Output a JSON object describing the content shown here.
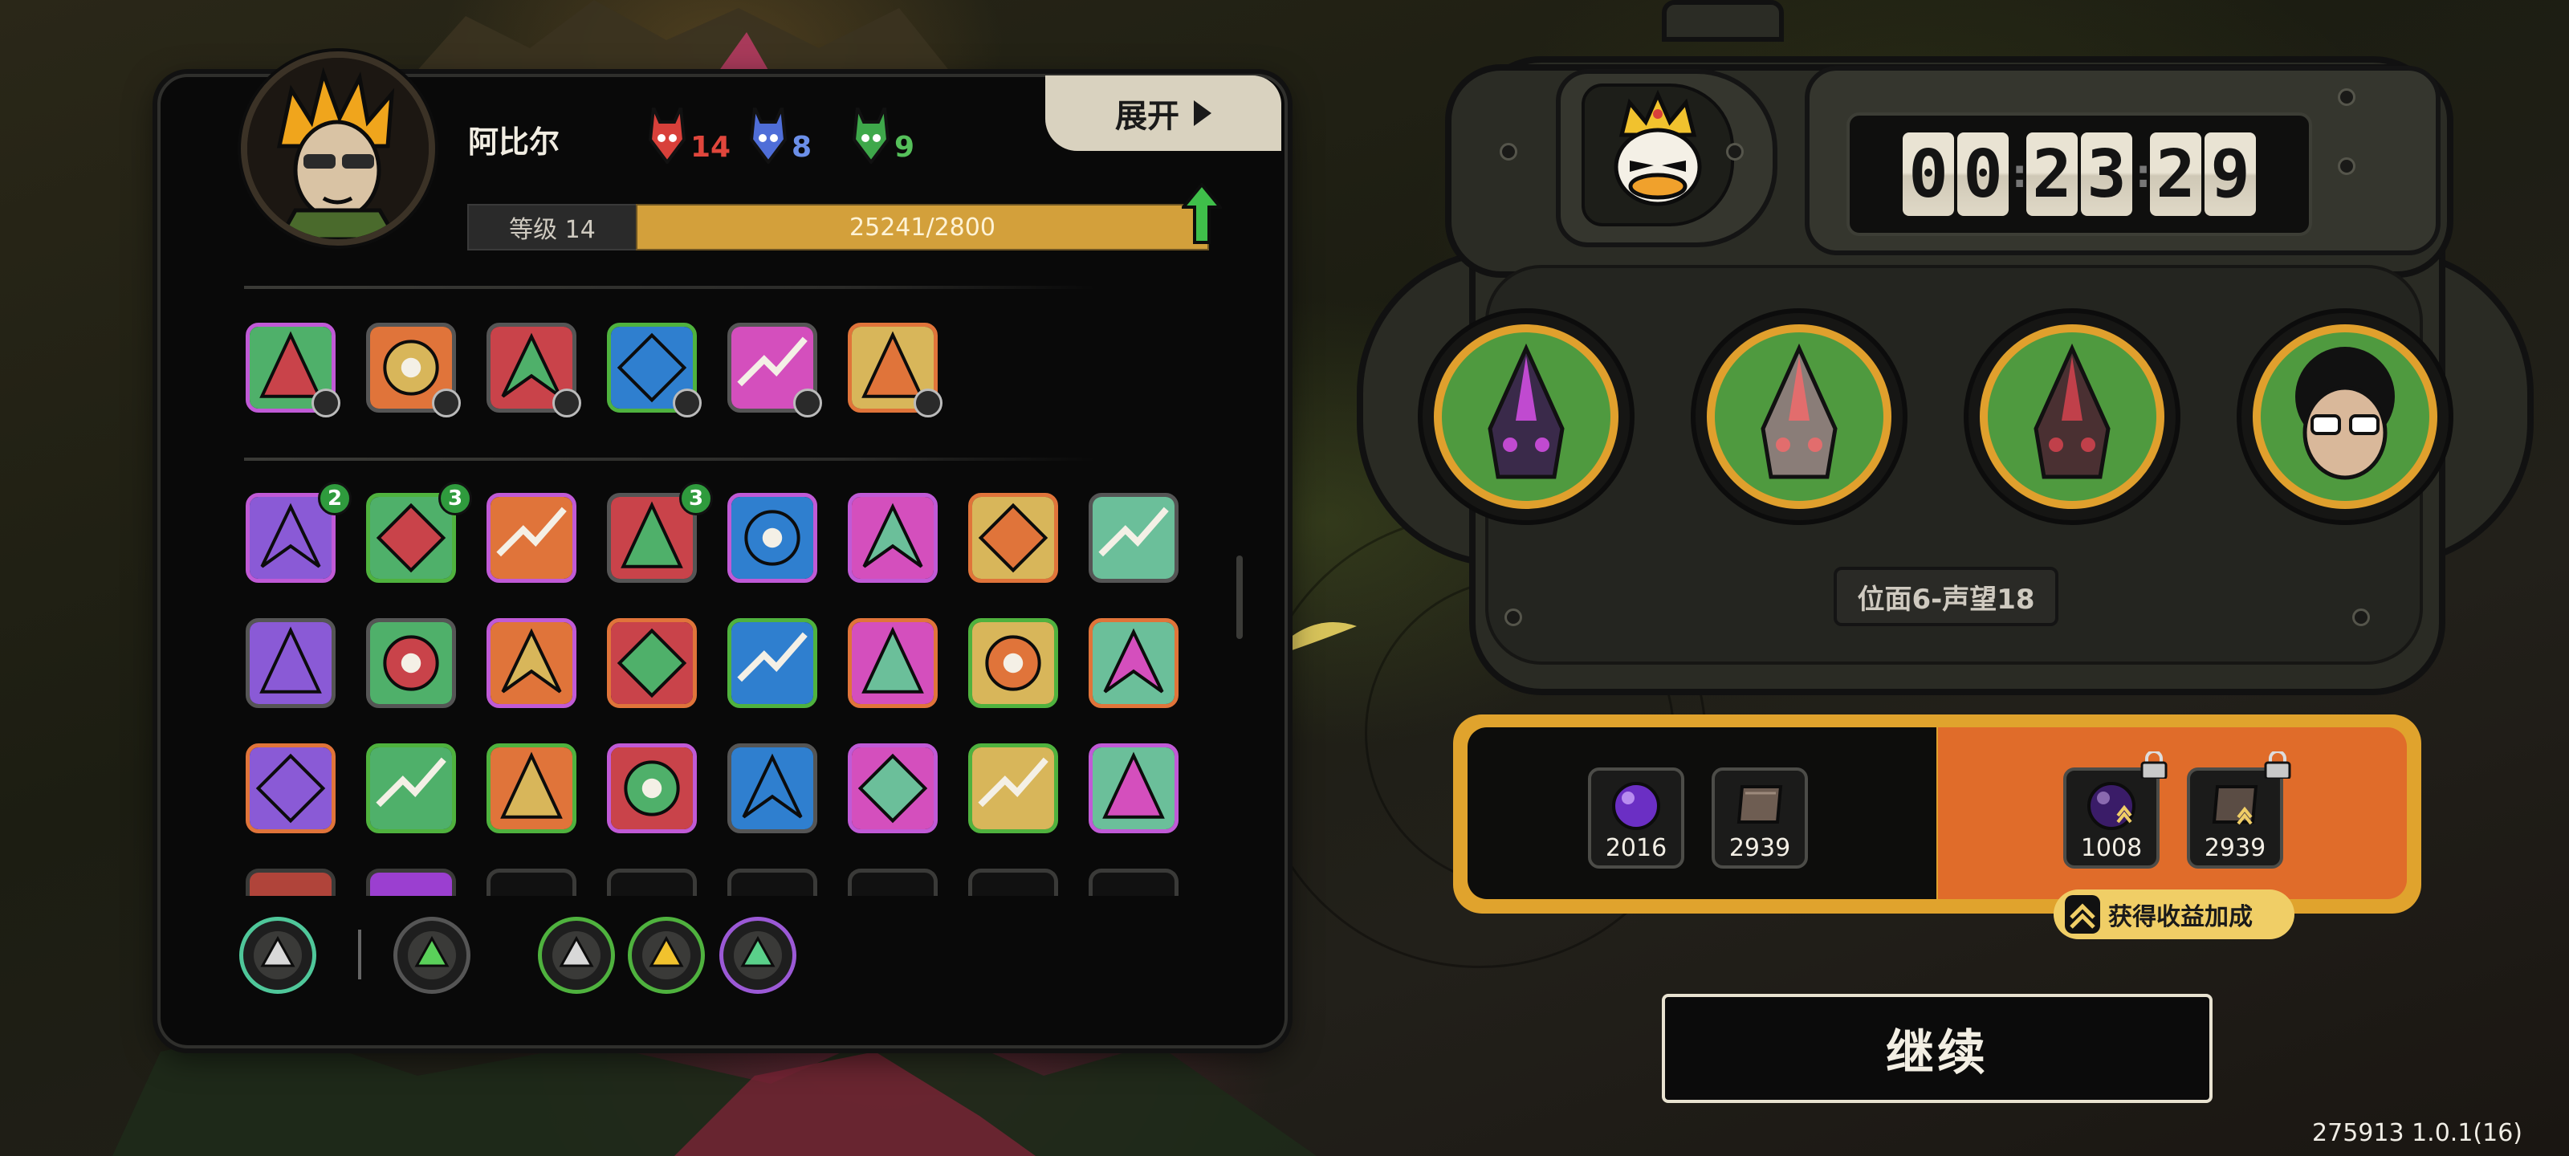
{
  "character": {
    "name": "阿比尔",
    "level_label": "等级 14",
    "xp_text": "25241/2800",
    "xp_progress": 1.0
  },
  "expand_button": {
    "label": "展开"
  },
  "resources": [
    {
      "icon": "red-mask-icon",
      "value": "14",
      "color": "#e0463c"
    },
    {
      "icon": "blue-mask-icon",
      "value": "8",
      "color": "#6b8fe8"
    },
    {
      "icon": "green-mask-icon",
      "value": "9",
      "color": "#55c05a"
    }
  ],
  "equipped_skills": [
    {
      "icon": "crosshair-skill-icon",
      "border": "#c05ad6"
    },
    {
      "icon": "diamond-shard-skill-icon",
      "border": "#555555"
    },
    {
      "icon": "green-spike-skill-icon",
      "border": "#555555"
    },
    {
      "icon": "flame-beast-skill-icon",
      "border": "#4fb23e"
    },
    {
      "icon": "twin-blade-skill-icon",
      "border": "#555555"
    },
    {
      "icon": "heart-vine-skill-icon",
      "border": "#e0743a"
    }
  ],
  "collection_grid": [
    {
      "icon": "crossed-guns-icon",
      "border": "#c05ad6",
      "count": "2"
    },
    {
      "icon": "flame-claw-icon",
      "border": "#4fb23e",
      "count": "3"
    },
    {
      "icon": "red-figure-icon",
      "border": "#c05ad6"
    },
    {
      "icon": "lightning-strike-icon",
      "border": "#555555",
      "count": "3"
    },
    {
      "icon": "spear-volley-icon",
      "border": "#c05ad6"
    },
    {
      "icon": "green-slash-icon",
      "border": "#c05ad6"
    },
    {
      "icon": "fire-burst-icon",
      "border": "#e0743a"
    },
    {
      "icon": "compass-wheel-icon",
      "border": "#555555"
    },
    {
      "icon": "green-wave-icon",
      "border": "#555555"
    },
    {
      "icon": "pink-feather-icon",
      "border": "#555555"
    },
    {
      "icon": "starburst-icon",
      "border": "#c05ad6"
    },
    {
      "icon": "blue-star-icon",
      "border": "#e0743a"
    },
    {
      "icon": "orange-dagger-icon",
      "border": "#4fb23e"
    },
    {
      "icon": "ammo-belt-icon",
      "border": "#e0743a"
    },
    {
      "icon": "pink-gem-ring-icon",
      "border": "#4fb23e"
    },
    {
      "icon": "shadow-mask-icon",
      "border": "#e0743a"
    },
    {
      "icon": "blue-cat-icon",
      "border": "#e0743a"
    },
    {
      "icon": "red-hand-icon",
      "border": "#4fb23e"
    },
    {
      "icon": "green-crystal-icon",
      "border": "#4fb23e"
    },
    {
      "icon": "teal-sword-icon",
      "border": "#c05ad6"
    },
    {
      "icon": "sunrise-icon",
      "border": "#555555"
    },
    {
      "icon": "red-target-icon",
      "border": "#c05ad6"
    },
    {
      "icon": "gold-crown-box-icon",
      "border": "#4fb23e"
    },
    {
      "icon": "blue-shield-burst-icon",
      "border": "#c05ad6"
    }
  ],
  "bottom_tabs": [
    {
      "icon": "tag-icon",
      "border": "#4fc79a"
    },
    {
      "icon": "green-chain-icon",
      "border": "#555555"
    },
    {
      "icon": "triangle-gem-icon",
      "border": "#4fb23e"
    },
    {
      "icon": "gold-crown-gem-icon",
      "border": "#4fb23e"
    },
    {
      "icon": "heart-gem-icon",
      "border": "#9b59d6"
    }
  ],
  "timer": {
    "hh": "00",
    "mm": "23",
    "ss": "29"
  },
  "team_slots": [
    {
      "icon": "dark-spike-monster-icon"
    },
    {
      "icon": "armored-beast-icon"
    },
    {
      "icon": "red-beak-monster-icon"
    },
    {
      "icon": "curly-hair-glasses-hero-icon"
    }
  ],
  "boss_icon": "crowned-duck-icon",
  "stage_label": "位面6-声望18",
  "rewards": {
    "base": [
      {
        "icon": "purple-orb-icon",
        "value": "2016"
      },
      {
        "icon": "book-icon",
        "value": "2939"
      }
    ],
    "bonus": [
      {
        "icon": "purple-orb-icon",
        "value": "1008",
        "locked": true
      },
      {
        "icon": "book-icon",
        "value": "2939",
        "locked": true
      }
    ],
    "bonus_label": "获得收益加成"
  },
  "continue_button": {
    "label": "继续"
  },
  "version_text": "275913 1.0.1(16)"
}
